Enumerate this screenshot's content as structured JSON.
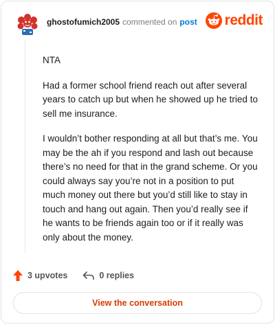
{
  "header": {
    "username": "ghostofumich2005",
    "meta_text": "commented on",
    "post_link": "post",
    "brand_word": "reddit"
  },
  "comment": {
    "paragraphs": [
      "NTA",
      "Had a former school friend reach out after several years to catch up but when he showed up he tried to sell me insurance.",
      "I wouldn’t bother responding at all but that’s me. You may be the ah if you respond and lash out because there’s no need for that in the grand scheme. Or you could always say you’re not in a position to put much money out there but you’d still like to stay in touch and hang out again. Then you’d really see if he wants to be friends again too or if it really was only about the money."
    ]
  },
  "actions": {
    "upvotes": "3 upvotes",
    "replies": "0 replies"
  },
  "cta": {
    "label": "View the conversation"
  },
  "colors": {
    "accent": "#ff4500",
    "link": "#0079d3",
    "cta_text": "#d93a00"
  },
  "icons": {
    "avatar": "avatar-icon",
    "brand": "reddit-logo-icon",
    "upvote": "upvote-arrow-icon",
    "reply": "reply-arrow-icon"
  }
}
